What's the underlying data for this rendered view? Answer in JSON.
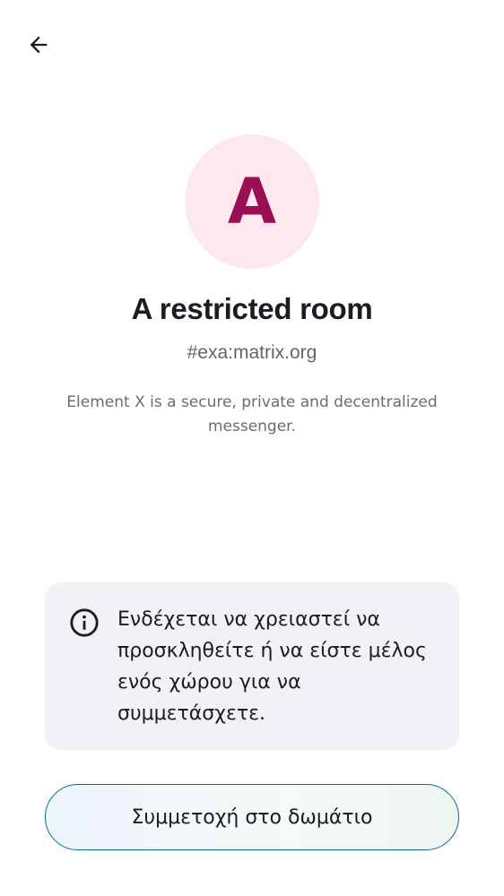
{
  "header": {
    "back_icon": "arrow-left-icon"
  },
  "room": {
    "avatar_letter": "A",
    "avatar_bg_color": "#fde8ed",
    "avatar_fg_color": "#9b0e54",
    "title": "A restricted room",
    "alias": "#exa:matrix.org",
    "description": "Element X is a secure, private and decentralized messenger."
  },
  "notice": {
    "icon": "info-icon",
    "text": "Ενδέχεται να χρειαστεί να προσκληθείτε ή να είστε μέλος ενός χώρου για να συμμετάσχετε."
  },
  "actions": {
    "join_label": "Συμμετοχή στο δωμάτιο"
  }
}
